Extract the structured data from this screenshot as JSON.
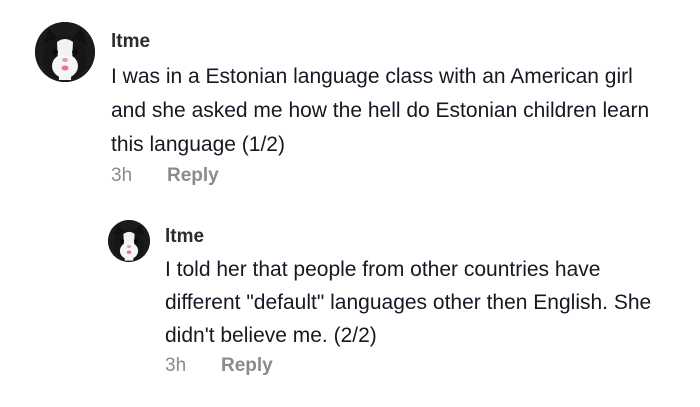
{
  "comments": [
    {
      "username": "ltme",
      "text": "I was in a Estonian language class with an American girl and she asked me how the hell do Estonian children learn this language (1/2)",
      "time": "3h",
      "reply_label": "Reply",
      "avatar_icon": "cat-avatar-icon"
    },
    {
      "username": "ltme",
      "text": "I told her that people from other countries have different \"default\" languages other then English. She didn't believe me. (2/2)",
      "time": "3h",
      "reply_label": "Reply",
      "avatar_icon": "cat-avatar-icon"
    }
  ]
}
